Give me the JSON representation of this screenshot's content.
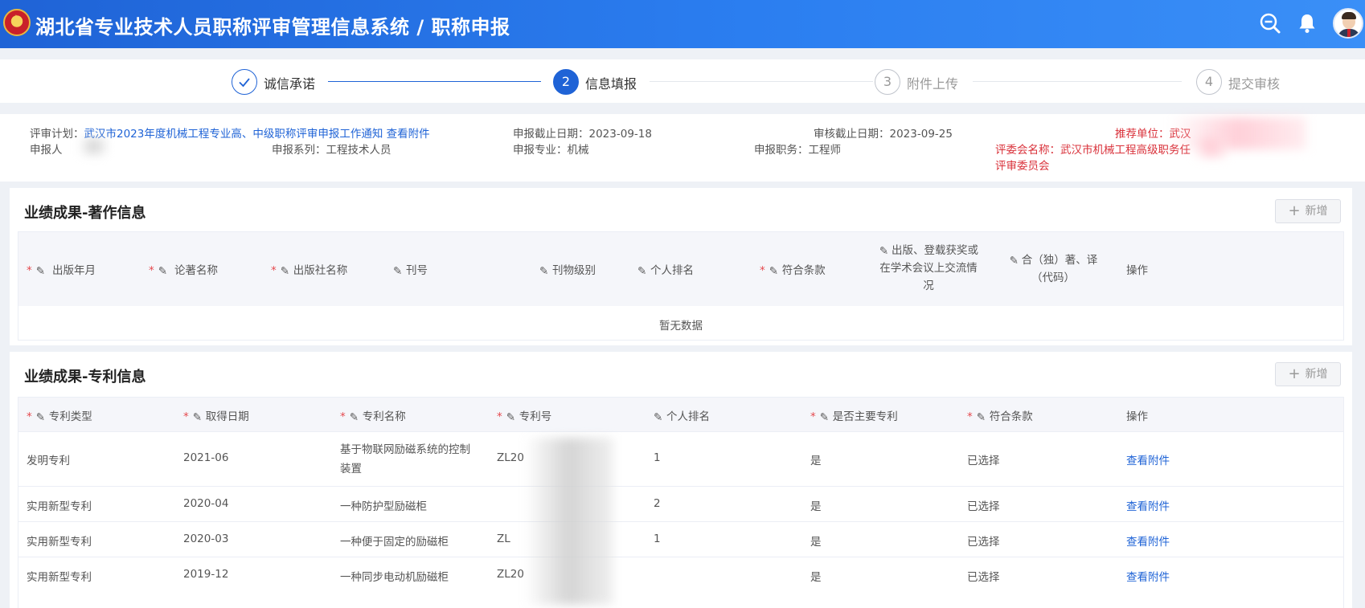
{
  "header": {
    "title": "湖北省专业技术人员职称评审管理信息系统 / 职称申报",
    "icons": [
      "zoom-out-icon",
      "bell-icon",
      "avatar"
    ]
  },
  "steps": [
    {
      "num": "✓",
      "label": "诚信承诺",
      "state": "done"
    },
    {
      "num": "2",
      "label": "信息填报",
      "state": "active"
    },
    {
      "num": "3",
      "label": "附件上传",
      "state": "pending"
    },
    {
      "num": "4",
      "label": "提交审核",
      "state": "pending"
    }
  ],
  "info": {
    "plan_label": "评审计划：",
    "plan_value": "武汉市2023年度机械工程专业高、中级职称评审申报工作通知",
    "plan_link": "查看附件",
    "deadline": "申报截止日期：2023-09-18",
    "audit_deadline": "审核截止日期：2023-09-25",
    "recommender": "推荐单位：武汉",
    "applicant": "申报人",
    "series": "申报系列：工程技术人员",
    "major": "申报专业：机械",
    "position": "申报职务：工程师",
    "committee_line1": "评委会名称：武汉市机械工程高级职务任",
    "committee_line2": "评审委员会"
  },
  "works": {
    "title": "业绩成果-著作信息",
    "add_label": "新增",
    "columns": [
      {
        "label": "出版年月",
        "required": true,
        "editable": true
      },
      {
        "label": "论著名称",
        "required": true,
        "editable": true
      },
      {
        "label": "出版社名称",
        "required": true,
        "editable": true
      },
      {
        "label": "刊号",
        "required": false,
        "editable": true
      },
      {
        "label": "刊物级别",
        "required": false,
        "editable": true
      },
      {
        "label": "个人排名",
        "required": false,
        "editable": true
      },
      {
        "label": "符合条款",
        "required": true,
        "editable": true
      },
      {
        "label": "出版、登载获奖或在学术会议上交流情况",
        "required": false,
        "editable": true
      },
      {
        "label": "合（独）著、译（代码）",
        "required": false,
        "editable": true
      },
      {
        "label": "操作",
        "required": false,
        "editable": false
      }
    ],
    "empty_text": "暂无数据"
  },
  "patents": {
    "title": "业绩成果-专利信息",
    "add_label": "新增",
    "columns": [
      {
        "label": "专利类型",
        "required": true,
        "editable": true
      },
      {
        "label": "取得日期",
        "required": true,
        "editable": true
      },
      {
        "label": "专利名称",
        "required": true,
        "editable": true
      },
      {
        "label": "专利号",
        "required": true,
        "editable": true
      },
      {
        "label": "个人排名",
        "required": false,
        "editable": true
      },
      {
        "label": "是否主要专利",
        "required": true,
        "editable": true
      },
      {
        "label": "符合条款",
        "required": true,
        "editable": true
      },
      {
        "label": "操作",
        "required": false,
        "editable": false
      }
    ],
    "rows": [
      {
        "type": "发明专利",
        "date": "2021-06",
        "name": "基于物联网励磁系统的控制装置",
        "no": "ZL20",
        "rank": "1",
        "main": "是",
        "clause": "已选择",
        "action": "查看附件"
      },
      {
        "type": "实用新型专利",
        "date": "2020-04",
        "name": "一种防护型励磁柜",
        "no": "",
        "rank": "2",
        "main": "是",
        "clause": "已选择",
        "action": "查看附件"
      },
      {
        "type": "实用新型专利",
        "date": "2020-03",
        "name": "一种便于固定的励磁柜",
        "no": "ZL",
        "rank": "1",
        "main": "是",
        "clause": "已选择",
        "action": "查看附件"
      },
      {
        "type": "实用新型专利",
        "date": "2019-12",
        "name": "一种同步电动机励磁柜",
        "no": "ZL20",
        "rank": "",
        "main": "是",
        "clause": "已选择",
        "action": "查看附件"
      }
    ]
  }
}
